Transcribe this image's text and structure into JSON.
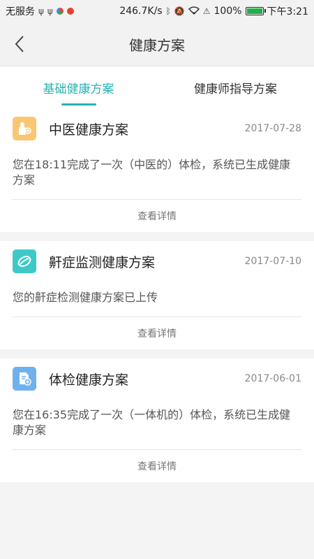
{
  "status_bar": {
    "carrier": "无服务",
    "speed": "246.7K/s",
    "battery": "100%",
    "time": "下午3:21"
  },
  "header": {
    "title": "健康方案"
  },
  "tabs": [
    {
      "label": "基础健康方案",
      "active": true
    },
    {
      "label": "健康师指导方案",
      "active": false
    }
  ],
  "cards": [
    {
      "icon": "tcm-doctor-icon",
      "icon_color": "#f9c773",
      "title": "中医健康方案",
      "date": "2017-07-28",
      "description": "您在18:11完成了一次（中医的）体检，系统已生成健康方案",
      "link": "查看详情"
    },
    {
      "icon": "leaf-icon",
      "icon_color": "#3ec9c7",
      "title": "鼾症监测健康方案",
      "date": "2017-07-10",
      "description": "您的鼾症检测健康方案已上传",
      "link": "查看详情"
    },
    {
      "icon": "document-add-icon",
      "icon_color": "#6fb1ec",
      "title": "体检健康方案",
      "date": "2017-06-01",
      "description": "您在16:35完成了一次（一体机的）体检，系统已生成健康方案",
      "link": "查看详情"
    }
  ]
}
